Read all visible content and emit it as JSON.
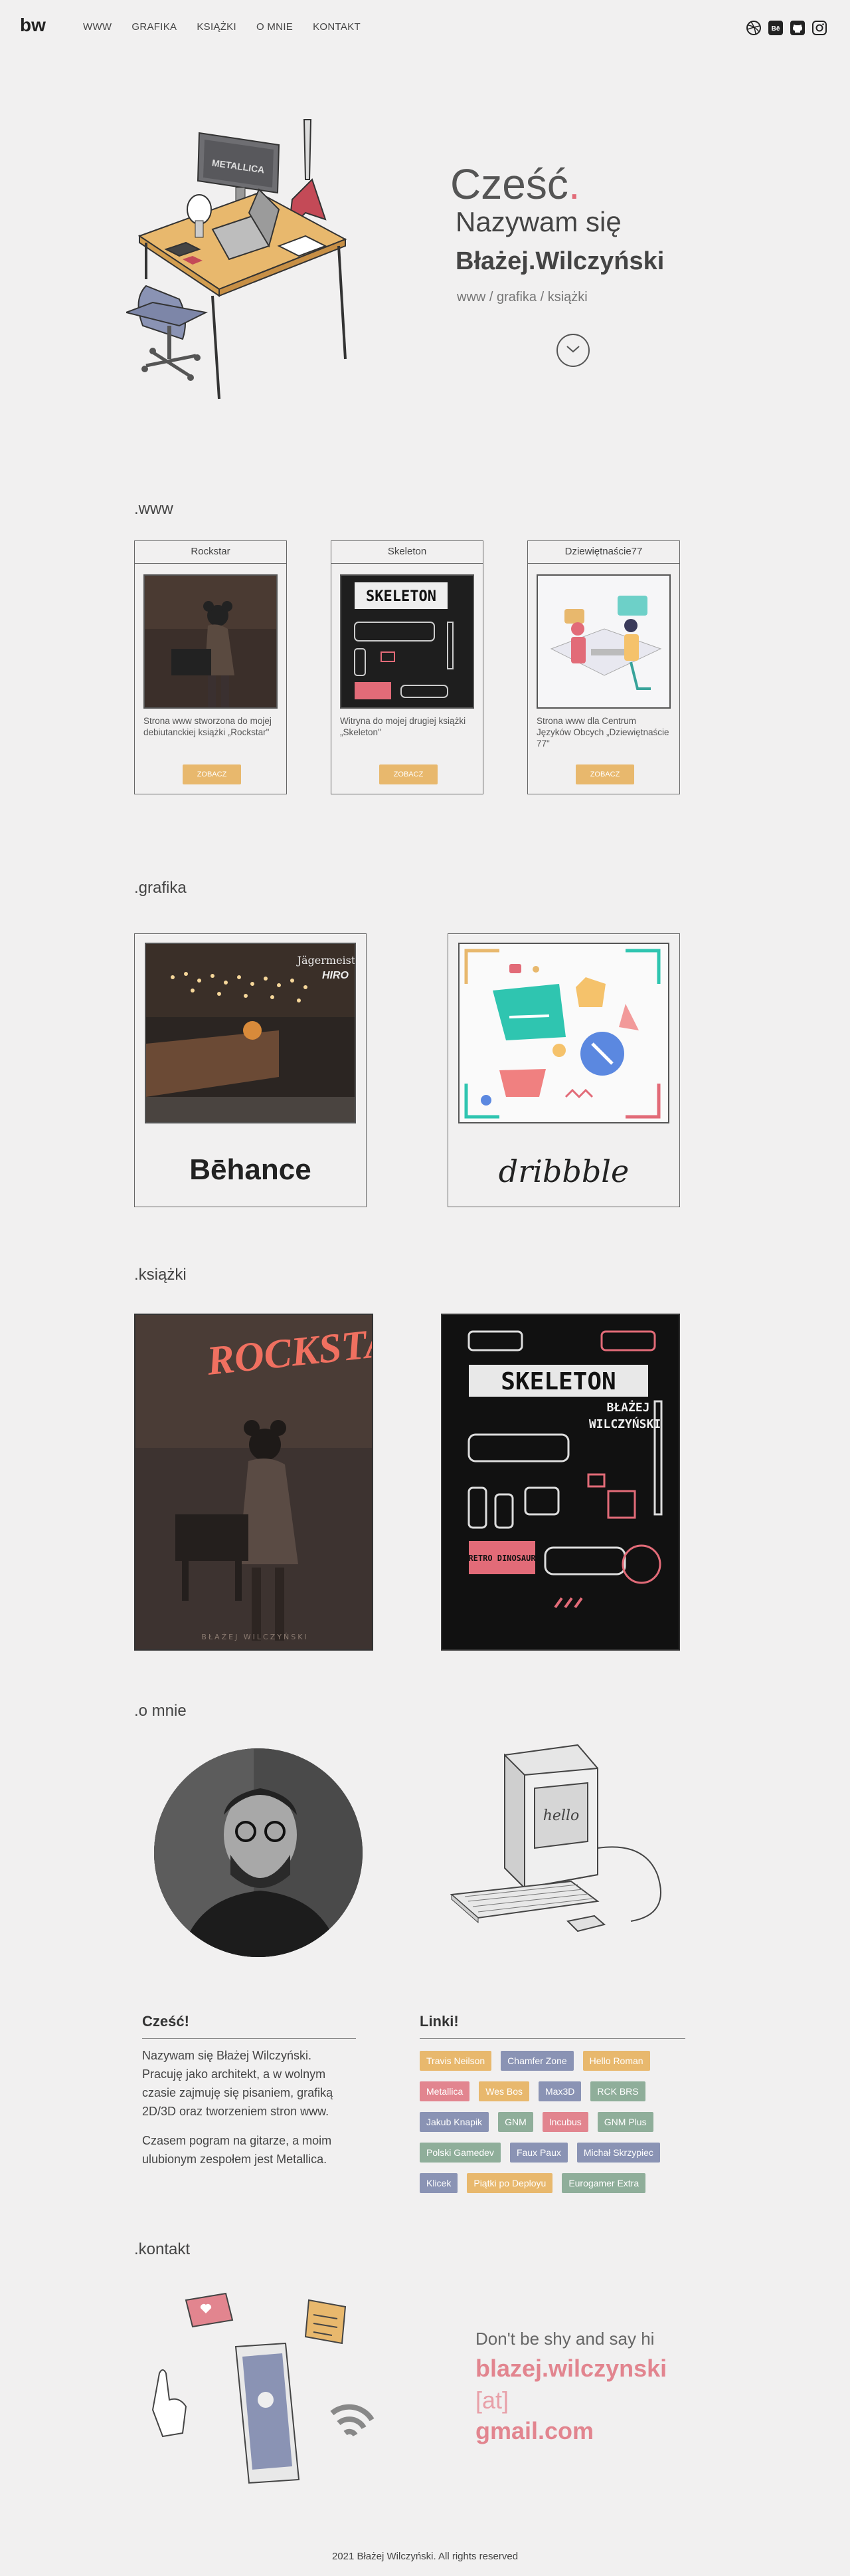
{
  "nav": {
    "logo": "bw",
    "items": [
      "WWW",
      "GRAFIKA",
      "KSIĄŻKI",
      "O MNIE",
      "KONTAKT"
    ],
    "social_icons": [
      "dribbble-icon",
      "behance-icon",
      "github-icon",
      "instagram-icon"
    ]
  },
  "hero": {
    "title": "Cześć",
    "dot": ".",
    "subtitle": "Nazywam się",
    "name": "Błażej.Wilczyński",
    "tags": "www / grafika / książki"
  },
  "www": {
    "title": ".www",
    "cards": [
      {
        "title": "Rockstar",
        "desc": "Strona www stworzona do mojej debiutanckiej książki „Rockstar\"",
        "button": "ZOBACZ"
      },
      {
        "title": "Skeleton",
        "desc": "Witryna  do mojej drugiej książki „Skeleton\"",
        "button": "ZOBACZ"
      },
      {
        "title": "Dziewiętnaście77",
        "desc": "Strona www dla Centrum Języków Obcych „Dziewiętnaście 77\"",
        "button": "ZOBACZ"
      }
    ]
  },
  "grafika": {
    "title": ".grafika",
    "behance": "Bēhance",
    "dribbble": "dribbble",
    "bar_sign_1": "Jägermeister",
    "bar_sign_2": "HIRO"
  },
  "ksiazki": {
    "title": ".książki",
    "book1_title": "ROCKSTAR",
    "book1_author": "BŁAŻEJ WILCZYŃSKI",
    "book2_title": "SKELETON",
    "book2_author_1": "BŁAŻEJ",
    "book2_author_2": "WILCZYŃSKI",
    "book2_sticker": "RETRO DINOSAUR"
  },
  "omnie": {
    "title": ".o mnie",
    "hello_heading": "Cześć!",
    "para1": "Nazywam się Błażej Wilczyński. Pracuję jako architekt, a w wolnym czasie zajmuję się pisaniem, grafiką 2D/3D oraz tworzeniem stron www.",
    "para2": "Czasem pogram na gitarze, a moim ulubionym zespołem jest Metallica.",
    "links_heading": "Linki!",
    "screen_text": "hello",
    "links": [
      {
        "label": "Travis Neilson",
        "color": "#e8b86d"
      },
      {
        "label": "Chamfer Zone",
        "color": "#8a93b4"
      },
      {
        "label": "Hello Roman",
        "color": "#e8b86d"
      },
      {
        "label": "Metallica",
        "color": "#e2858f"
      },
      {
        "label": "Wes Bos",
        "color": "#e8b86d"
      },
      {
        "label": "Max3D",
        "color": "#8a93b4"
      },
      {
        "label": "RCK BRS",
        "color": "#8fae9a"
      },
      {
        "label": "Jakub Knapik",
        "color": "#8a93b4"
      },
      {
        "label": "GNM",
        "color": "#8fae9a"
      },
      {
        "label": "Incubus",
        "color": "#e2858f"
      },
      {
        "label": "GNM Plus",
        "color": "#8fae9a"
      },
      {
        "label": "Polski Gamedev",
        "color": "#8fae9a"
      },
      {
        "label": "Faux Paux",
        "color": "#8a93b4"
      },
      {
        "label": "Michał Skrzypiec",
        "color": "#8a93b4"
      },
      {
        "label": "Klicek",
        "color": "#8a93b4"
      },
      {
        "label": "Piątki po Deployu",
        "color": "#e8b86d"
      },
      {
        "label": "Eurogamer Extra",
        "color": "#8fae9a"
      }
    ]
  },
  "kontakt": {
    "title": ".kontakt",
    "line1": "Don't be shy and say hi",
    "line2": "blazej.wilczynski",
    "line3": "[at]",
    "line4": "gmail.com"
  },
  "footer": "2021 Błażej Wilczyński. All rights reserved",
  "colors": {
    "accent": "#e26b78",
    "button": "#e8b86d",
    "background": "#f1f0f0"
  }
}
